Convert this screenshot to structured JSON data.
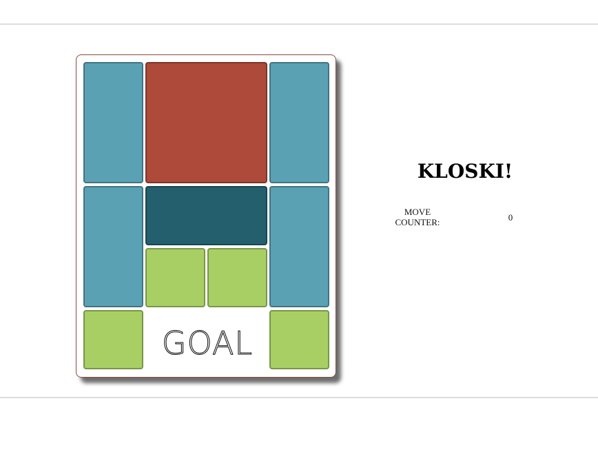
{
  "game": {
    "title": "KLOSKI!",
    "move_counter_label": "MOVE\nCOUNTER:",
    "move_counter_value": "0",
    "goal_label": "GOAL"
  },
  "colors": {
    "tall_block": "#5aa1b4",
    "big_block": "#ad4a3a",
    "wide_block": "#245f6e",
    "small_block": "#a8cf64"
  },
  "board": {
    "columns": 4,
    "rows": 5,
    "goal_exit": "bottom-center",
    "blocks": [
      {
        "type": "tall",
        "col": 1,
        "row": 1
      },
      {
        "type": "big",
        "col": 2,
        "row": 1
      },
      {
        "type": "tall",
        "col": 4,
        "row": 1
      },
      {
        "type": "tall",
        "col": 1,
        "row": 3
      },
      {
        "type": "wide",
        "col": 2,
        "row": 3
      },
      {
        "type": "tall",
        "col": 4,
        "row": 3
      },
      {
        "type": "small",
        "col": 2,
        "row": 4
      },
      {
        "type": "small",
        "col": 3,
        "row": 4
      },
      {
        "type": "small",
        "col": 1,
        "row": 5
      },
      {
        "type": "small",
        "col": 4,
        "row": 5
      }
    ]
  }
}
